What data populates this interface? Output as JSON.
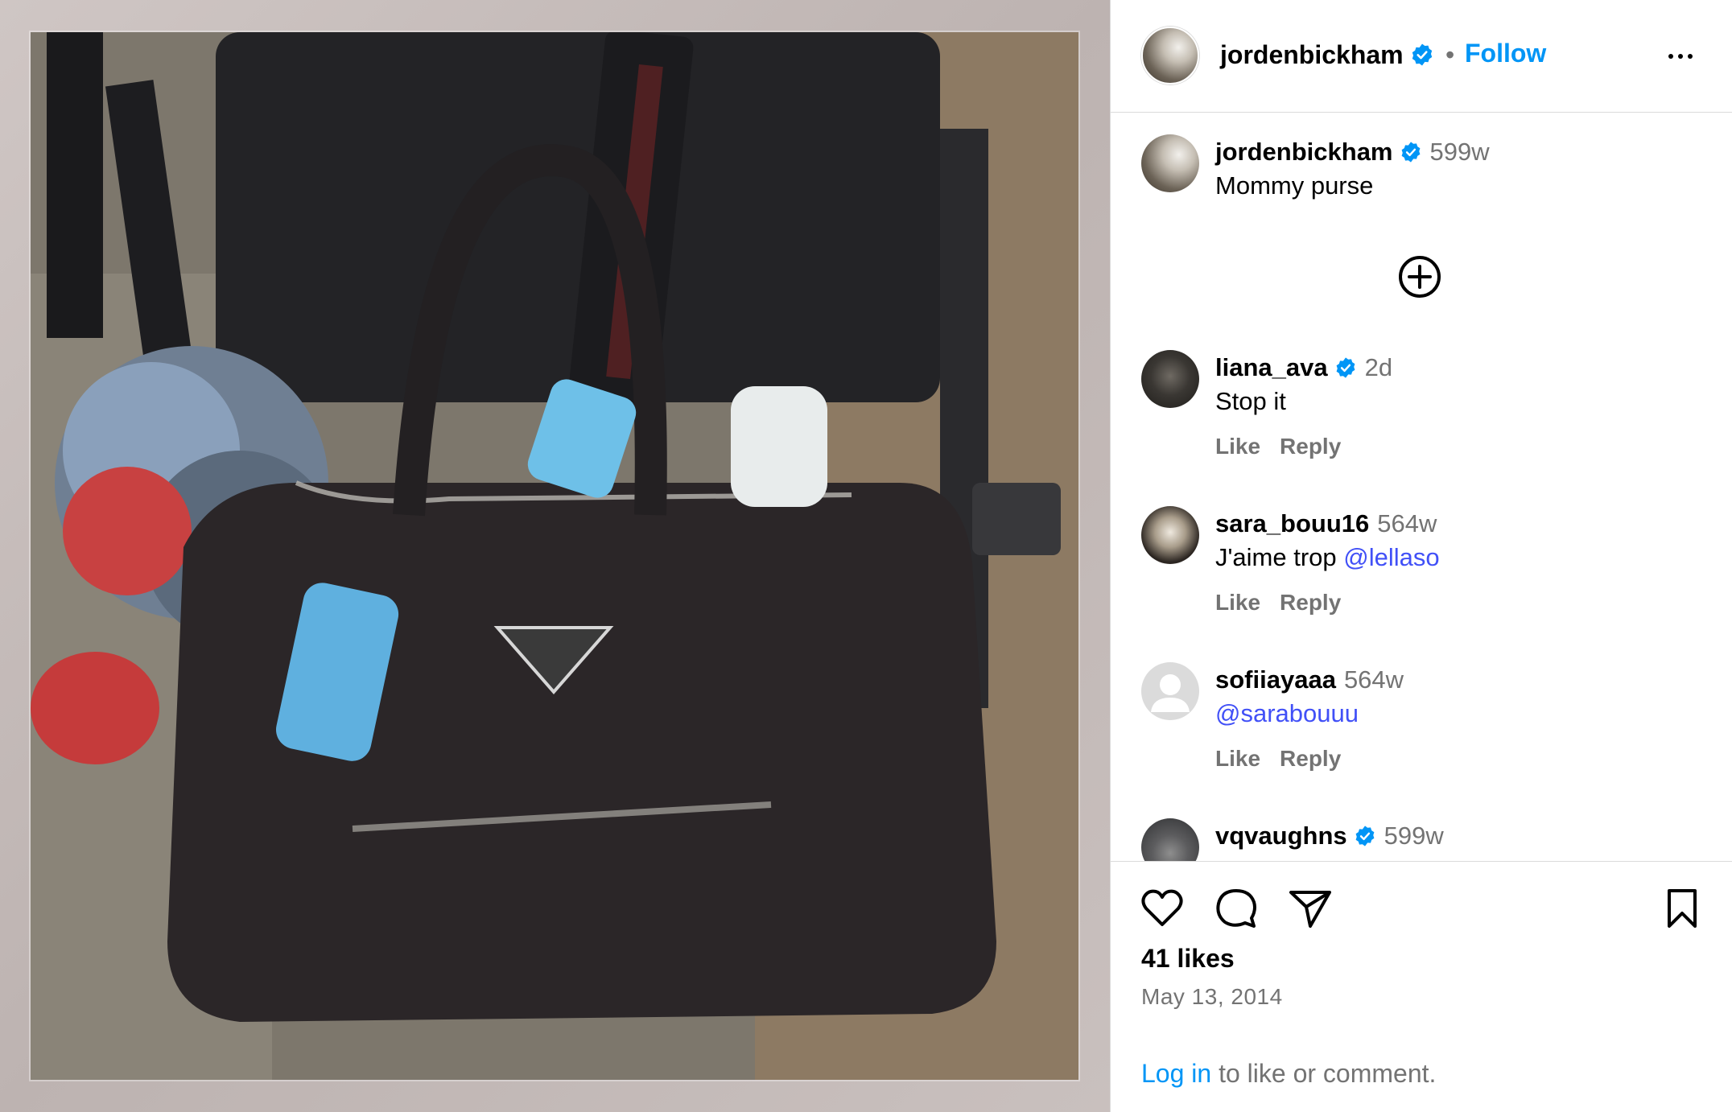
{
  "post": {
    "image_alt": "Black Prada nylon bag hanging on a stroller with hand sanitizer and a fur keychain",
    "image_label": "PRADA"
  },
  "header": {
    "username": "jordenbickham",
    "separator": "•",
    "follow_label": "Follow"
  },
  "caption": {
    "username": "jordenbickham",
    "time": "599w",
    "text": "Mommy purse"
  },
  "comments": [
    {
      "username": "liana_ava",
      "verified": true,
      "time": "2d",
      "text": "Stop it",
      "mention": "",
      "like_label": "Like",
      "reply_label": "Reply"
    },
    {
      "username": "sara_bouu16",
      "verified": false,
      "time": "564w",
      "text": "J'aime trop ",
      "mention": "@lellaso",
      "like_label": "Like",
      "reply_label": "Reply"
    },
    {
      "username": "sofiiayaaa",
      "verified": false,
      "time": "564w",
      "text": "",
      "mention": "@sarabouuu",
      "like_label": "Like",
      "reply_label": "Reply"
    },
    {
      "username": "vqvaughns",
      "verified": true,
      "time": "599w",
      "text": "",
      "mention": ""
    }
  ],
  "stats": {
    "likes": "41 likes",
    "date": "May 13, 2014"
  },
  "login": {
    "link_text": "Log in",
    "rest_text": " to like or comment."
  },
  "colors": {
    "accent": "#0095f6",
    "mention": "#4150f7",
    "muted": "#737373",
    "border": "#dbdbdb",
    "verified": "#0095f6"
  },
  "icons": [
    "more-icon",
    "verified-icon",
    "add-circle-icon",
    "heart-icon",
    "comment-icon",
    "share-icon",
    "bookmark-icon",
    "default-avatar-icon"
  ]
}
